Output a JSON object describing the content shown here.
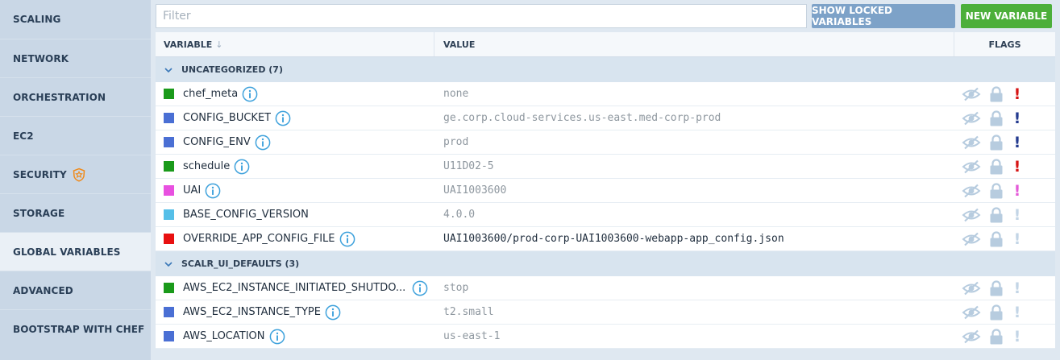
{
  "colors": {
    "green": "#1a9a1a",
    "blue": "#4a6fd4",
    "magenta": "#e850e0",
    "cyan": "#55bfe8",
    "red": "#e81010",
    "flag_icon": "#b7ccdf",
    "excl_red": "#d61414",
    "excl_blue": "#233a8f",
    "excl_magenta": "#e45ad8",
    "excl_light": "#c3d5e6"
  },
  "sidebar": {
    "items": [
      {
        "label": "SCALING"
      },
      {
        "label": "NETWORK"
      },
      {
        "label": "ORCHESTRATION"
      },
      {
        "label": "EC2"
      },
      {
        "label": "SECURITY",
        "icon": "security-badge-icon"
      },
      {
        "label": "STORAGE"
      },
      {
        "label": "GLOBAL VARIABLES",
        "active": true
      },
      {
        "label": "ADVANCED"
      },
      {
        "label": "BOOTSTRAP WITH CHEF"
      }
    ]
  },
  "toolbar": {
    "filter_placeholder": "Filter",
    "filter_value": "",
    "show_locked_label": "SHOW LOCKED VARIABLES",
    "new_variable_label": "NEW VARIABLE"
  },
  "grid": {
    "columns": {
      "variable": "VARIABLE",
      "value": "VALUE",
      "flags": "FLAGS"
    },
    "groups": [
      {
        "title": "UNCATEGORIZED (7)",
        "rows": [
          {
            "name": "chef_meta",
            "value": "none",
            "color": "green",
            "info": true,
            "value_dark": false,
            "excl": "excl_red"
          },
          {
            "name": "CONFIG_BUCKET",
            "value": "ge.corp.cloud-services.us-east.med-corp-prod",
            "color": "blue",
            "info": true,
            "value_dark": false,
            "excl": "excl_blue"
          },
          {
            "name": "CONFIG_ENV",
            "value": "prod",
            "color": "blue",
            "info": true,
            "value_dark": false,
            "excl": "excl_blue"
          },
          {
            "name": "schedule",
            "value": "U11D02-5",
            "color": "green",
            "info": true,
            "value_dark": false,
            "excl": "excl_red"
          },
          {
            "name": "UAI",
            "value": "UAI1003600",
            "color": "magenta",
            "info": true,
            "value_dark": false,
            "excl": "excl_magenta"
          },
          {
            "name": "BASE_CONFIG_VERSION",
            "value": "4.0.0",
            "color": "cyan",
            "info": false,
            "value_dark": false,
            "excl": "excl_light"
          },
          {
            "name": "OVERRIDE_APP_CONFIG_FILE",
            "value": "UAI1003600/prod-corp-UAI1003600-webapp-app_config.json",
            "color": "red",
            "info": true,
            "value_dark": true,
            "excl": "excl_light"
          }
        ]
      },
      {
        "title": "SCALR_UI_DEFAULTS (3)",
        "rows": [
          {
            "name": "AWS_EC2_INSTANCE_INITIATED_SHUTDO...",
            "value": "stop",
            "color": "green",
            "info": true,
            "info_right": true,
            "value_dark": false,
            "excl": "excl_light"
          },
          {
            "name": "AWS_EC2_INSTANCE_TYPE",
            "value": "t2.small",
            "color": "blue",
            "info": true,
            "value_dark": false,
            "excl": "excl_light"
          },
          {
            "name": "AWS_LOCATION",
            "value": "us-east-1",
            "color": "blue",
            "info": true,
            "value_dark": false,
            "excl": "excl_light"
          }
        ]
      }
    ]
  }
}
